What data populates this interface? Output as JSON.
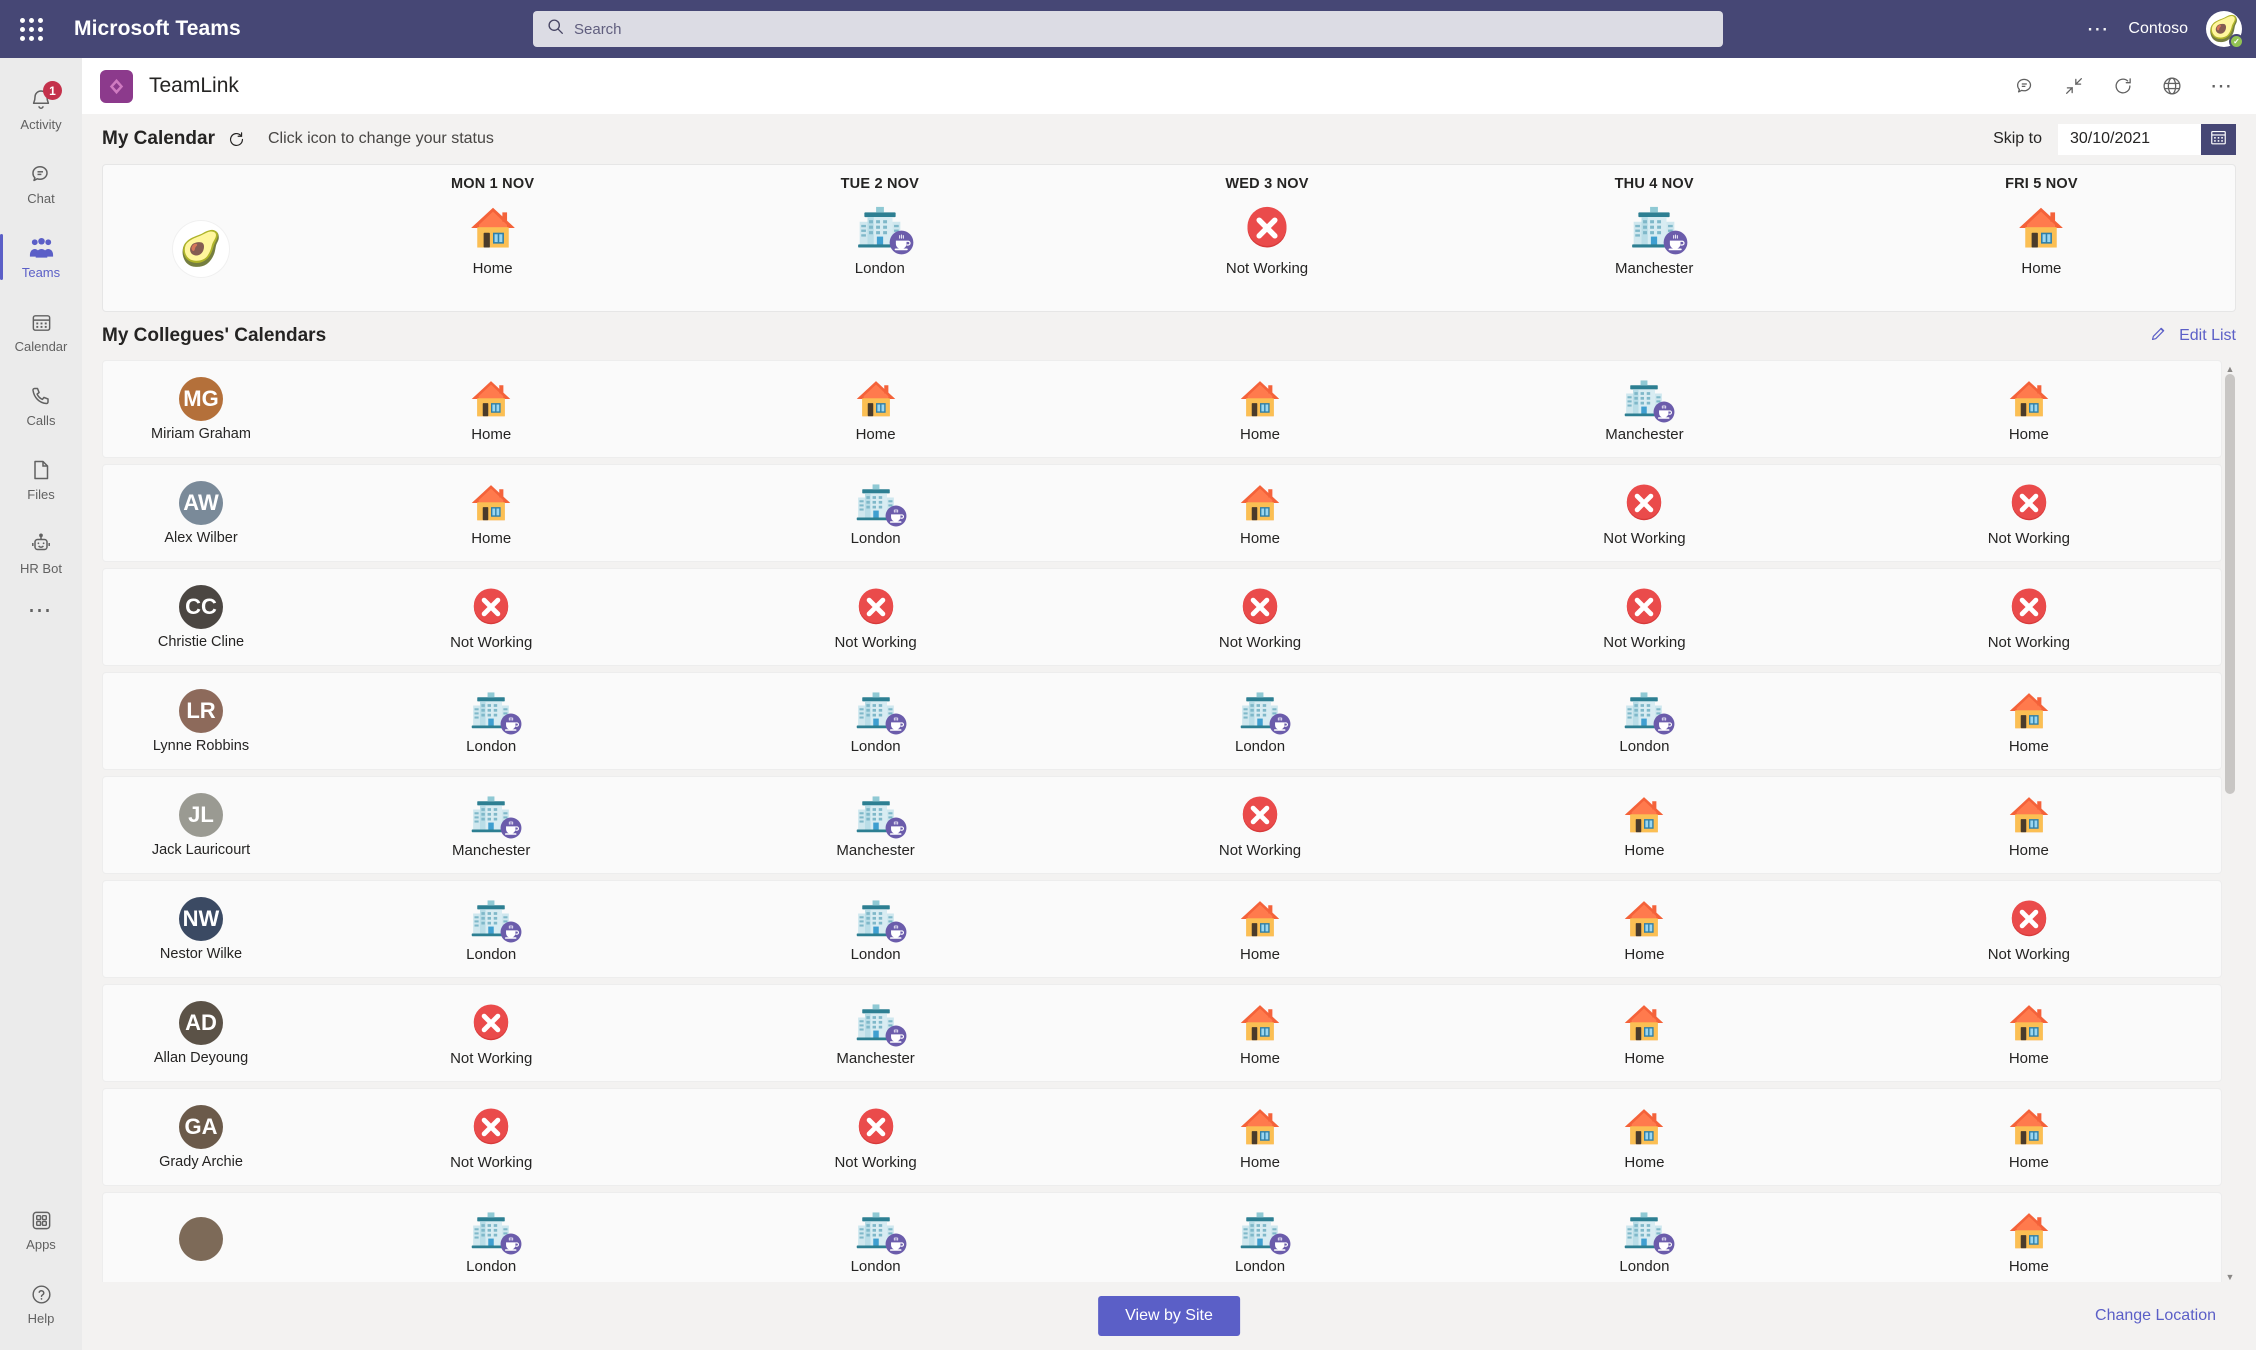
{
  "titlebar": {
    "waffle_icon": "app-launcher-icon",
    "app_title": "Microsoft Teams",
    "search": {
      "placeholder": "Search",
      "value": "",
      "icon": "search-icon"
    },
    "more_icon": "ellipsis-icon",
    "tenant": "Contoso",
    "avatar": {
      "name": "avatar",
      "emoji": "🥑",
      "presence": "available"
    }
  },
  "rail": {
    "items": [
      {
        "label": "Activity",
        "icon": "bell-icon",
        "badge": "1",
        "active": false
      },
      {
        "label": "Chat",
        "icon": "chat-icon",
        "badge": "",
        "active": false
      },
      {
        "label": "Teams",
        "icon": "teams-icon",
        "badge": "",
        "active": true
      },
      {
        "label": "Calendar",
        "icon": "calendar-icon",
        "badge": "",
        "active": false
      },
      {
        "label": "Calls",
        "icon": "phone-icon",
        "badge": "",
        "active": false
      },
      {
        "label": "Files",
        "icon": "file-icon",
        "badge": "",
        "active": false
      },
      {
        "label": "HR Bot",
        "icon": "robot-icon",
        "badge": "",
        "active": false
      }
    ],
    "more_icon": "ellipsis-icon",
    "bottom": [
      {
        "label": "Apps",
        "icon": "apps-icon"
      },
      {
        "label": "Help",
        "icon": "help-icon"
      }
    ]
  },
  "app_header": {
    "logo_icon": "teamlink-logo-icon",
    "title": "TeamLink",
    "actions": [
      {
        "name": "feedback-icon"
      },
      {
        "name": "collapse-icon"
      },
      {
        "name": "refresh-icon"
      },
      {
        "name": "globe-icon"
      }
    ],
    "more_icon": "ellipsis-icon"
  },
  "my_calendar": {
    "title": "My Calendar",
    "refresh_icon": "refresh-icon",
    "hint": "Click icon to change your status",
    "skip_label": "Skip to",
    "skip_value": "30/10/2021",
    "calendar_button_icon": "calendar-picker-icon",
    "me_avatar_emoji": "🥑",
    "days": [
      "MON 1 NOV",
      "TUE 2 NOV",
      "WED 3 NOV",
      "THU 4 NOV",
      "FRI 5 NOV"
    ],
    "statuses": [
      "Home",
      "London",
      "Not Working",
      "Manchester",
      "Home"
    ]
  },
  "colleagues": {
    "title": "My Collegues' Calendars",
    "edit_label": "Edit List",
    "edit_icon": "pencil-icon",
    "rows": [
      {
        "name": "Miriam Graham",
        "initials": "MG",
        "color": "#b4703a",
        "statuses": [
          "Home",
          "Home",
          "Home",
          "Manchester",
          "Home"
        ]
      },
      {
        "name": "Alex Wilber",
        "initials": "AW",
        "color": "#7a8a99",
        "statuses": [
          "Home",
          "London",
          "Home",
          "Not Working",
          "Not Working"
        ]
      },
      {
        "name": "Christie Cline",
        "initials": "CC",
        "color": "#4b4642",
        "statuses": [
          "Not Working",
          "Not Working",
          "Not Working",
          "Not Working",
          "Not Working"
        ]
      },
      {
        "name": "Lynne Robbins",
        "initials": "LR",
        "color": "#8d6a5b",
        "statuses": [
          "London",
          "London",
          "London",
          "London",
          "Home"
        ]
      },
      {
        "name": "Jack Lauricourt",
        "initials": "JL",
        "color": "#9a9a92",
        "statuses": [
          "Manchester",
          "Manchester",
          "Not Working",
          "Home",
          "Home"
        ]
      },
      {
        "name": "Nestor Wilke",
        "initials": "NW",
        "color": "#3b4a63",
        "statuses": [
          "London",
          "London",
          "Home",
          "Home",
          "Not Working"
        ]
      },
      {
        "name": "Allan Deyoung",
        "initials": "AD",
        "color": "#5b5247",
        "statuses": [
          "Not Working",
          "Manchester",
          "Home",
          "Home",
          "Home"
        ]
      },
      {
        "name": "Grady Archie",
        "initials": "GA",
        "color": "#6b5a4a",
        "statuses": [
          "Not Working",
          "Not Working",
          "Home",
          "Home",
          "Home"
        ]
      },
      {
        "name": "",
        "initials": "",
        "color": "#7d6a58",
        "statuses": [
          "London",
          "London",
          "London",
          "London",
          "Home"
        ]
      }
    ]
  },
  "scrollbar": {
    "up_icon": "scroll-up-arrow-icon",
    "down_icon": "scroll-down-arrow-icon",
    "thumb": "scrollbar-thumb"
  },
  "footer": {
    "view_by_site": "View by Site",
    "change_location": "Change Location"
  },
  "colors": {
    "teams_purple": "#464775",
    "accent": "#5b5fc7",
    "badge_red": "#c4314b",
    "not_working_red": "#e04b4b",
    "app_logo": "#8c3a8c"
  }
}
